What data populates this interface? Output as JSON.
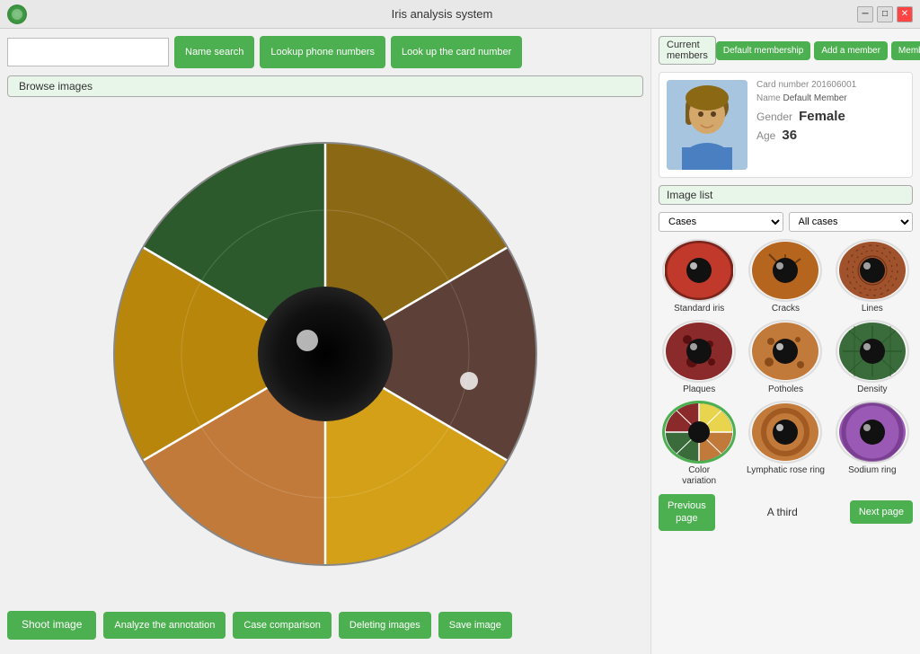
{
  "window": {
    "title": "Iris analysis system"
  },
  "toolbar": {
    "search_placeholder": "",
    "name_search": "Name\nsearch",
    "lookup_phone": "Lookup phone\nnumbers",
    "lookup_card": "Look up the\ncard number",
    "default_membership": "Default\nmembership",
    "add_member": "Add a\nmember",
    "membership_management": "Membership\nmanagement"
  },
  "browse": {
    "label": "Browse images"
  },
  "member": {
    "current_label": "Current\nmembers",
    "card_number_label": "Card number",
    "card_number": "201606001",
    "name_label": "Name",
    "name_value": "Default Member",
    "gender_label": "Gender",
    "gender_value": "Female",
    "age_label": "Age",
    "age_value": "36"
  },
  "image_list": {
    "label": "Image list",
    "filter1_label": "Cases",
    "filter2_label": "All cases",
    "filter1_options": [
      "Cases"
    ],
    "filter2_options": [
      "All cases"
    ],
    "items": [
      {
        "id": "standard",
        "label": "Standard iris",
        "selected": false,
        "color1": "#c0392b",
        "color2": "#922b21"
      },
      {
        "id": "cracks",
        "label": "Cracks",
        "selected": false,
        "color1": "#b5651d",
        "color2": "#8B4513"
      },
      {
        "id": "lines",
        "label": "Lines",
        "selected": false,
        "color1": "#a0522d",
        "color2": "#6b3a1f"
      },
      {
        "id": "plaques",
        "label": "Plaques",
        "selected": false,
        "color1": "#8b0000",
        "color2": "#5a0000"
      },
      {
        "id": "potholes",
        "label": "Potholes",
        "selected": false,
        "color1": "#c17a3a",
        "color2": "#8b5a2b"
      },
      {
        "id": "density",
        "label": "Density",
        "selected": false,
        "color1": "#5d8a5d",
        "color2": "#3a6b3a"
      },
      {
        "id": "color_variation",
        "label": "Color\nvariation",
        "selected": true,
        "color1": "#e8d44d",
        "color2": "#b8a030"
      },
      {
        "id": "lymphatic",
        "label": "Lymphatic rose ring",
        "selected": false,
        "color1": "#c17a3a",
        "color2": "#8b5a2b"
      },
      {
        "id": "sodium",
        "label": "Sodium ring",
        "selected": false,
        "color1": "#9b59b6",
        "color2": "#7d3c98"
      }
    ]
  },
  "bottom_toolbar": {
    "shoot_image": "Shoot image",
    "analyze_annotation": "Analyze the\nannotation",
    "case_comparison": "Case comparison",
    "deleting_images": "Deleting\nimages",
    "save_image": "Save image"
  },
  "pagination": {
    "previous_page": "Previous\npage",
    "a_third": "A third",
    "next_page": "Next page"
  }
}
